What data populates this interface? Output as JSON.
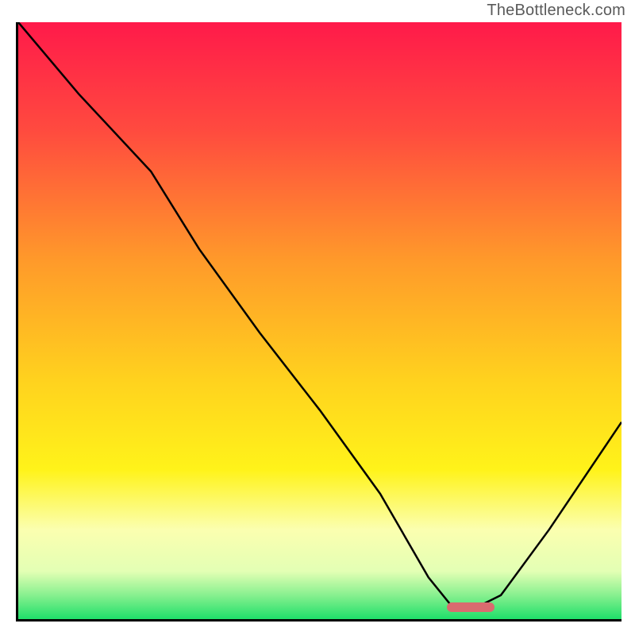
{
  "watermark": "TheBottleneck.com",
  "chart_data": {
    "type": "line",
    "title": "",
    "xlabel": "",
    "ylabel": "",
    "xlim": [
      0,
      100
    ],
    "ylim": [
      0,
      100
    ],
    "gradient_stops": [
      {
        "pct": 0,
        "color": "#ff1a4a"
      },
      {
        "pct": 18,
        "color": "#ff4a3f"
      },
      {
        "pct": 40,
        "color": "#ff9a2a"
      },
      {
        "pct": 60,
        "color": "#ffd21e"
      },
      {
        "pct": 75,
        "color": "#fff31a"
      },
      {
        "pct": 85,
        "color": "#fbffb0"
      },
      {
        "pct": 92,
        "color": "#e3ffb4"
      },
      {
        "pct": 96,
        "color": "#87f08f"
      },
      {
        "pct": 100,
        "color": "#1fdf6a"
      }
    ],
    "series": [
      {
        "name": "bottleneck-curve",
        "x": [
          0,
          10,
          22,
          30,
          40,
          50,
          60,
          68,
          72,
          76,
          80,
          88,
          100
        ],
        "y": [
          100,
          88,
          75,
          62,
          48,
          35,
          21,
          7,
          2,
          2,
          4,
          15,
          33
        ]
      }
    ],
    "marker": {
      "x_start": 71,
      "x_end": 79,
      "y": 2,
      "color": "#d96b6f",
      "name": "optimal-range"
    }
  }
}
